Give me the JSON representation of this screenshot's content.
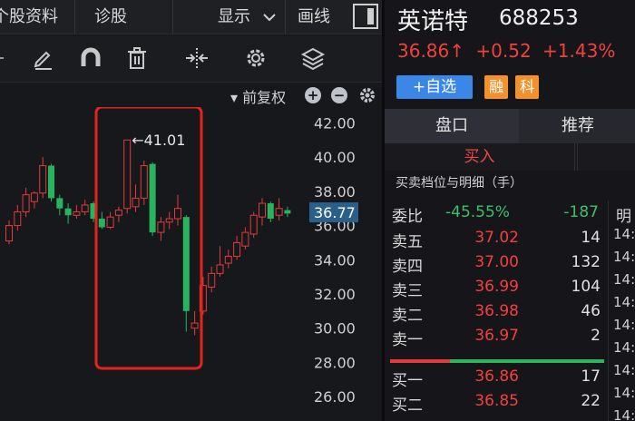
{
  "left_header": {
    "tabs": [
      "个股资料",
      "诊股",
      "显示",
      "画线"
    ],
    "fq_label": "前复权"
  },
  "toolbar_icons": [
    "pen-icon",
    "magnet-icon",
    "trash-icon",
    "split-icon",
    "gear-icon",
    "layers-icon"
  ],
  "chart": {
    "y_ticks": [
      "42.00",
      "40.00",
      "38.00",
      "36.00",
      "34.00",
      "32.00",
      "30.00",
      "28.00",
      "26.00"
    ],
    "current_price_tag": "36.77",
    "peak_annotation": "←41.01",
    "colors": {
      "up": "#e23b3b",
      "down": "#28b45f",
      "highlight_box": "#e2231a"
    }
  },
  "chart_data": {
    "type": "candlestick",
    "ylim": [
      25,
      42.5
    ],
    "peak_label": 41.01,
    "last_price": 36.77,
    "candles": [
      {
        "o": 35.1,
        "c": 36.0,
        "h": 36.3,
        "l": 34.9
      },
      {
        "o": 36.0,
        "c": 36.8,
        "h": 37.2,
        "l": 35.7
      },
      {
        "o": 36.8,
        "c": 37.8,
        "h": 38.2,
        "l": 36.5
      },
      {
        "o": 37.4,
        "c": 37.9,
        "h": 38.0,
        "l": 37.0
      },
      {
        "o": 37.9,
        "c": 39.5,
        "h": 40.0,
        "l": 37.6
      },
      {
        "o": 39.5,
        "c": 37.6,
        "h": 39.6,
        "l": 37.4
      },
      {
        "o": 37.6,
        "c": 37.0,
        "h": 37.8,
        "l": 36.6
      },
      {
        "o": 37.0,
        "c": 36.6,
        "h": 37.3,
        "l": 36.1
      },
      {
        "o": 36.6,
        "c": 36.8,
        "h": 37.2,
        "l": 36.4
      },
      {
        "o": 36.8,
        "c": 37.2,
        "h": 37.5,
        "l": 36.6
      },
      {
        "o": 37.3,
        "c": 36.4,
        "h": 37.4,
        "l": 36.2
      },
      {
        "o": 36.4,
        "c": 35.9,
        "h": 36.8,
        "l": 35.8
      },
      {
        "o": 35.9,
        "c": 36.5,
        "h": 36.8,
        "l": 35.8
      },
      {
        "o": 36.6,
        "c": 36.9,
        "h": 37.1,
        "l": 36.2
      },
      {
        "o": 37.0,
        "c": 41.0,
        "h": 41.01,
        "l": 36.7
      },
      {
        "o": 37.1,
        "c": 37.6,
        "h": 38.4,
        "l": 36.8
      },
      {
        "o": 37.6,
        "c": 39.5,
        "h": 39.8,
        "l": 37.2
      },
      {
        "o": 39.6,
        "c": 35.6,
        "h": 39.7,
        "l": 35.4
      },
      {
        "o": 35.6,
        "c": 36.2,
        "h": 36.5,
        "l": 35.1
      },
      {
        "o": 36.2,
        "c": 36.4,
        "h": 36.8,
        "l": 35.8
      },
      {
        "o": 36.4,
        "c": 37.0,
        "h": 37.8,
        "l": 36.0
      },
      {
        "o": 36.5,
        "c": 31.0,
        "h": 36.6,
        "l": 29.8
      },
      {
        "o": 30.0,
        "c": 30.3,
        "h": 31.0,
        "l": 29.6
      },
      {
        "o": 31.0,
        "c": 32.5,
        "h": 33.0,
        "l": 30.8
      },
      {
        "o": 32.4,
        "c": 33.2,
        "h": 33.6,
        "l": 32.1
      },
      {
        "o": 33.2,
        "c": 33.7,
        "h": 34.8,
        "l": 33.0
      },
      {
        "o": 33.8,
        "c": 34.2,
        "h": 34.6,
        "l": 33.5
      },
      {
        "o": 34.2,
        "c": 35.0,
        "h": 35.4,
        "l": 34.0
      },
      {
        "o": 34.8,
        "c": 35.6,
        "h": 35.9,
        "l": 34.6
      },
      {
        "o": 35.5,
        "c": 36.6,
        "h": 36.8,
        "l": 35.3
      },
      {
        "o": 36.5,
        "c": 37.3,
        "h": 37.6,
        "l": 36.0
      },
      {
        "o": 37.3,
        "c": 36.4,
        "h": 37.4,
        "l": 36.2
      },
      {
        "o": 36.6,
        "c": 37.0,
        "h": 37.6,
        "l": 36.3
      },
      {
        "o": 36.9,
        "c": 36.7,
        "h": 37.1,
        "l": 36.5
      }
    ]
  },
  "stock": {
    "name": "英诺特",
    "code": "688253",
    "price": "36.86↑",
    "change": "+0.52",
    "change_pct": "+1.43%"
  },
  "actions": {
    "watch_label": "+自选",
    "tag_rong": "融",
    "tag_ke": "科"
  },
  "tabs": {
    "pankou": "盘口",
    "tuijian": "推荐"
  },
  "subtabs": {
    "buy": "买入"
  },
  "detail_title": "买卖档位与明细（手）",
  "weibi": {
    "label": "委比",
    "value": "-45.55%",
    "diff": "-187"
  },
  "asks": [
    {
      "label": "卖五",
      "price": "37.02",
      "vol": "14"
    },
    {
      "label": "卖四",
      "price": "37.00",
      "vol": "132"
    },
    {
      "label": "卖三",
      "price": "36.99",
      "vol": "104"
    },
    {
      "label": "卖二",
      "price": "36.98",
      "vol": "46"
    },
    {
      "label": "卖一",
      "price": "36.97",
      "vol": "2"
    }
  ],
  "bids": [
    {
      "label": "买一",
      "price": "36.86",
      "vol": "17"
    },
    {
      "label": "买二",
      "price": "36.85",
      "vol": "22"
    }
  ],
  "realtime": {
    "header": "明",
    "times": [
      "14:",
      "14:",
      "14:",
      "14:",
      "14:",
      "14:",
      "14:",
      "14:",
      "14:"
    ]
  }
}
